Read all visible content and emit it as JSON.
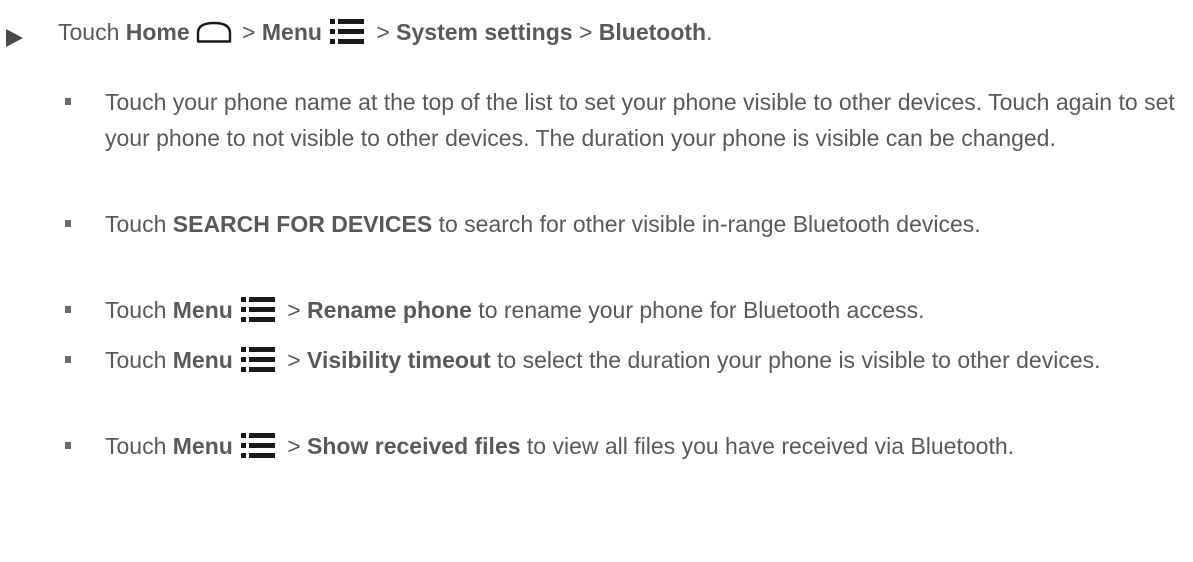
{
  "step": {
    "prefix": "Touch ",
    "home_label": "Home",
    "sep1": " > ",
    "menu_label": "Menu",
    "sep2": " > ",
    "system_settings": "System settings",
    "sep3": " > ",
    "bluetooth": "Bluetooth",
    "end": "."
  },
  "items": [
    {
      "text": "Touch your phone name at the top of the list to set your phone visible to other devices. Touch again to set your phone to not visible to other devices. The duration your phone is visible can be changed."
    },
    {
      "pre": "Touch ",
      "bold": "SEARCH FOR DEVICES",
      "post": " to search for other visible in-range Bluetooth devices."
    },
    {
      "pre": "Touch ",
      "menu_label": "Menu",
      "sep": " > ",
      "bold": "Rename phone",
      "post": " to rename your phone for Bluetooth access."
    },
    {
      "pre": "Touch ",
      "menu_label": "Menu",
      "sep": " > ",
      "bold": "Visibility timeout",
      "post": " to select the duration your phone is visible to other devices."
    },
    {
      "pre": "Touch ",
      "menu_label": "Menu",
      "sep": " > ",
      "bold": "Show received files",
      "post": " to view all files you have received via Bluetooth."
    }
  ],
  "icons": {
    "home": "home-icon",
    "menu": "menu-icon"
  },
  "colors": {
    "text": "#595959",
    "icon": "#1a1a1a"
  }
}
